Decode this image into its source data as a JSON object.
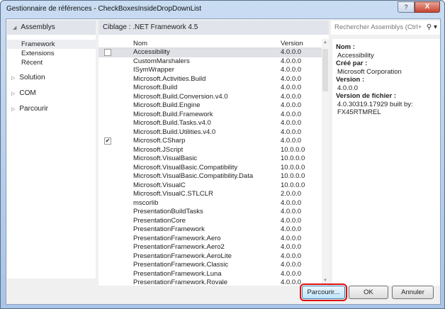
{
  "window": {
    "title": "Gestionnaire de références - CheckBoxesInsideDropDownList",
    "help": "?",
    "close": "X"
  },
  "sidebar": {
    "header": "Assemblys",
    "subitems": [
      "Framework",
      "Extensions",
      "Récent"
    ],
    "items": [
      "Solution",
      "COM",
      "Parcourir"
    ]
  },
  "main": {
    "targeting": "Ciblage : .NET Framework 4.5",
    "search_placeholder": "Rechercher Assemblys (Ctrl+",
    "col_name": "Nom",
    "col_version": "Version",
    "rows": [
      {
        "name": "Accessibility",
        "version": "4.0.0.0",
        "checked": false,
        "selected": true
      },
      {
        "name": "CustomMarshalers",
        "version": "4.0.0.0"
      },
      {
        "name": "ISymWrapper",
        "version": "4.0.0.0"
      },
      {
        "name": "Microsoft.Activities.Build",
        "version": "4.0.0.0"
      },
      {
        "name": "Microsoft.Build",
        "version": "4.0.0.0"
      },
      {
        "name": "Microsoft.Build.Conversion.v4.0",
        "version": "4.0.0.0"
      },
      {
        "name": "Microsoft.Build.Engine",
        "version": "4.0.0.0"
      },
      {
        "name": "Microsoft.Build.Framework",
        "version": "4.0.0.0"
      },
      {
        "name": "Microsoft.Build.Tasks.v4.0",
        "version": "4.0.0.0"
      },
      {
        "name": "Microsoft.Build.Utilities.v4.0",
        "version": "4.0.0.0"
      },
      {
        "name": "Microsoft.CSharp",
        "version": "4.0.0.0",
        "checked": true
      },
      {
        "name": "Microsoft.JScript",
        "version": "10.0.0.0"
      },
      {
        "name": "Microsoft.VisualBasic",
        "version": "10.0.0.0"
      },
      {
        "name": "Microsoft.VisualBasic.Compatibility",
        "version": "10.0.0.0"
      },
      {
        "name": "Microsoft.VisualBasic.Compatibility.Data",
        "version": "10.0.0.0"
      },
      {
        "name": "Microsoft.VisualC",
        "version": "10.0.0.0"
      },
      {
        "name": "Microsoft.VisualC.STLCLR",
        "version": "2.0.0.0"
      },
      {
        "name": "mscorlib",
        "version": "4.0.0.0"
      },
      {
        "name": "PresentationBuildTasks",
        "version": "4.0.0.0"
      },
      {
        "name": "PresentationCore",
        "version": "4.0.0.0"
      },
      {
        "name": "PresentationFramework",
        "version": "4.0.0.0"
      },
      {
        "name": "PresentationFramework.Aero",
        "version": "4.0.0.0"
      },
      {
        "name": "PresentationFramework.Aero2",
        "version": "4.0.0.0"
      },
      {
        "name": "PresentationFramework.AeroLite",
        "version": "4.0.0.0"
      },
      {
        "name": "PresentationFramework.Classic",
        "version": "4.0.0.0"
      },
      {
        "name": "PresentationFramework.Luna",
        "version": "4.0.0.0"
      },
      {
        "name": "PresentationFramework.Royale",
        "version": "4.0.0.0"
      }
    ]
  },
  "details": {
    "name_label": "Nom :",
    "name": "Accessibility",
    "creator_label": "Créé par :",
    "creator": "Microsoft Corporation",
    "version_label": "Version :",
    "version": "4.0.0.0",
    "file_version_label": "Version de fichier :",
    "file_version": "4.0.30319.17929 built by:",
    "file_version_2": "FX45RTMREL"
  },
  "buttons": {
    "browse": "Parcourir...",
    "ok": "OK",
    "cancel": "Annuler"
  }
}
